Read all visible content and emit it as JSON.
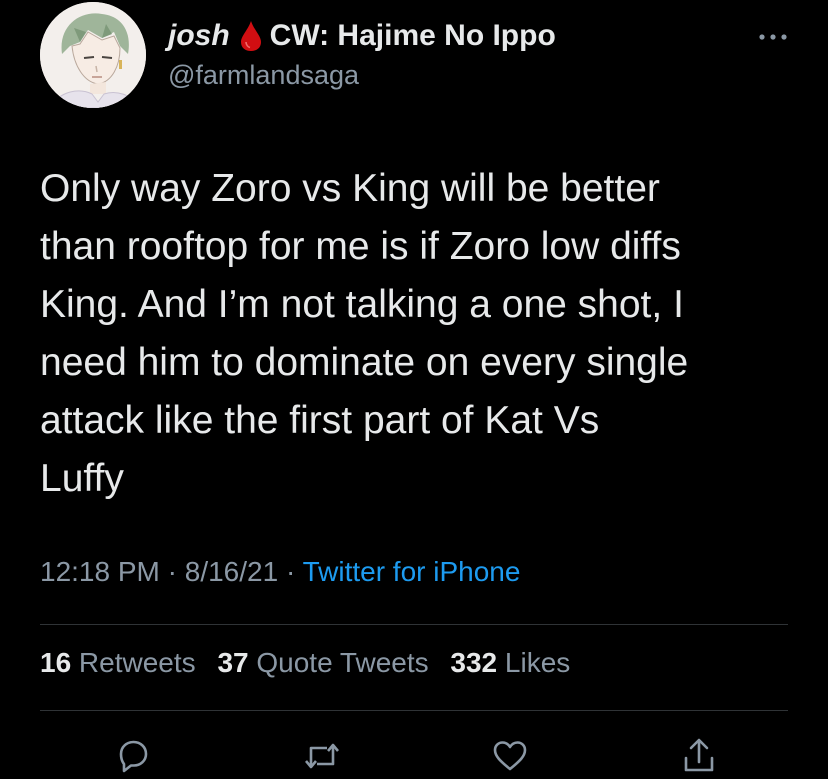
{
  "author": {
    "display_name_first": "josh",
    "display_name_rest": "CW: Hajime No Ippo",
    "handle": "@farmlandsaga",
    "avatar": "anime-character-avatar",
    "drop_emoji": "blood-drop-icon"
  },
  "tweet": {
    "text_lines": [
      "Only way Zoro vs King will be better",
      "than rooftop for me is if Zoro low diffs",
      "King. And I’m not talking a one shot, I",
      "need him to dominate on every single",
      "attack like the first part of Kat Vs",
      "Luffy"
    ]
  },
  "meta": {
    "time": "12:18 PM",
    "sep1": " · ",
    "date": "8/16/21",
    "sep2": " · ",
    "source": "Twitter for iPhone"
  },
  "stats": {
    "retweets_count": "16",
    "retweets_label": " Retweets",
    "quotes_count": "37",
    "quotes_label": " Quote Tweets",
    "likes_count": "332",
    "likes_label": " Likes"
  },
  "actions": [
    "reply-icon",
    "retweet-icon",
    "like-icon",
    "share-icon"
  ],
  "colors": {
    "background": "#000000",
    "text": "#e7e9ea",
    "secondary": "#8b98a5",
    "link": "#1d9bf0",
    "divider": "#2f3336",
    "drop": "#d10e12"
  }
}
